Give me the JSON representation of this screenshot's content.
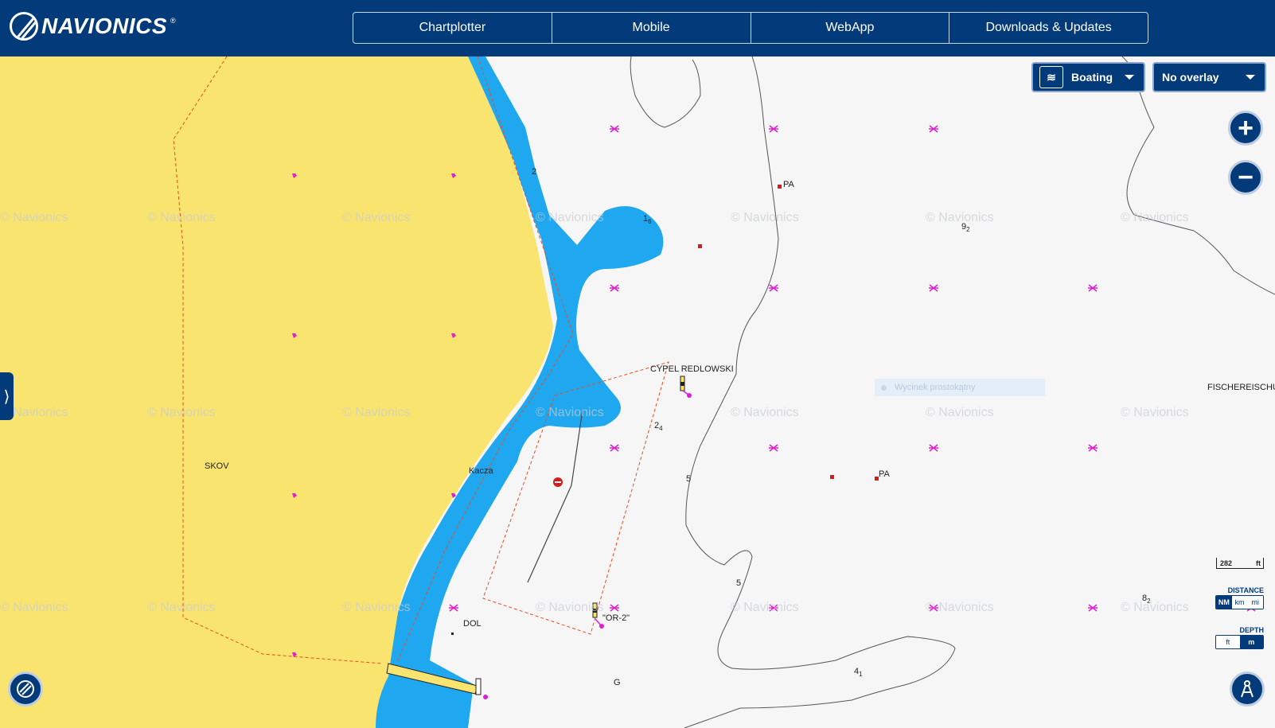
{
  "header": {
    "brand": "NAVIONICS",
    "brand_mark": "®",
    "nav": [
      "Chartplotter",
      "Mobile",
      "WebApp",
      "Downloads & Updates"
    ]
  },
  "controls": {
    "mode_dropdown": "Boating",
    "overlay_dropdown": "No overlay",
    "zoom_in": "+",
    "zoom_out": "−",
    "side_tab": "⟩"
  },
  "map": {
    "watermark": "© Navionics",
    "labels": {
      "cypel": "CYPEL REDLOWSKI",
      "skov": "SKOV",
      "kacza": "Kacza",
      "dol": "DOL",
      "or2": "\"OR-2\"",
      "fischer": "FISCHEREISCHUT",
      "g": "G",
      "pa1": "PA",
      "pa2": "PA"
    },
    "soundings": [
      {
        "id": "s1",
        "main": "2",
        "sub": ""
      },
      {
        "id": "s2",
        "main": "1",
        "sub": "6"
      },
      {
        "id": "s3",
        "main": "9",
        "sub": "2"
      },
      {
        "id": "s4",
        "main": "2",
        "sub": "4"
      },
      {
        "id": "s5",
        "main": "5",
        "sub": ""
      },
      {
        "id": "s6",
        "main": "5",
        "sub": ""
      },
      {
        "id": "s7",
        "main": "8",
        "sub": "2"
      },
      {
        "id": "s8",
        "main": "4",
        "sub": "1"
      }
    ],
    "tooltip": "Wycinek prostokątny"
  },
  "scale": {
    "value": "282",
    "unit": "ft"
  },
  "units": {
    "distance_label": "DISTANCE",
    "distance_options": [
      "NM",
      "km",
      "mi"
    ],
    "distance_selected": "NM",
    "depth_label": "DEPTH",
    "depth_options": [
      "ft",
      "m"
    ],
    "depth_selected": "m"
  },
  "colors": {
    "header": "#023a7a",
    "land": "#f8e46f",
    "shallow_water": "#1fa8ef",
    "deep_water": "#f6f6f7",
    "marker": "#e020d0",
    "boundary": "#f04a1c"
  }
}
